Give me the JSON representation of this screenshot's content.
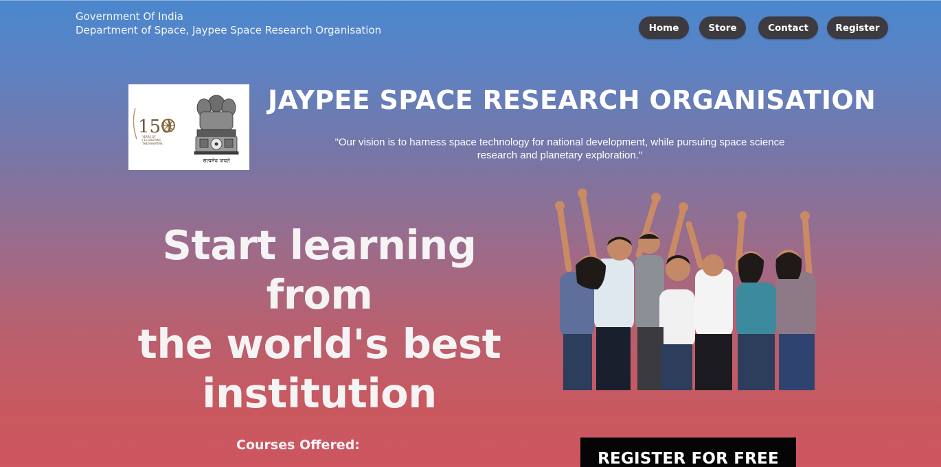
{
  "header": {
    "line1": "Government Of India",
    "line2": "Department of Space, Jaypee Space Research Organisation"
  },
  "nav": {
    "items": [
      {
        "label": "Home"
      },
      {
        "label": "Store"
      },
      {
        "label": "Contact"
      },
      {
        "label": "Register"
      }
    ]
  },
  "org": {
    "title": "JAYPEE SPACE RESEARCH ORGANISATION",
    "vision_line1": "\"Our vision is to harness space technology for national development,  while pursuing space science",
    "vision_line2": "research and planetary exploration.\""
  },
  "emblem": {
    "badge_number": "150",
    "badge_caption1": "YEARS OF",
    "badge_caption2": "CELEBRATING",
    "badge_caption3": "THE MAHATMA",
    "motto": "सत्यमेव जयते"
  },
  "hero": {
    "line1": "Start learning from",
    "line2": "the world's best",
    "line3": "institution"
  },
  "courses": {
    "label": "Courses Offered:"
  },
  "cta": {
    "label": "REGISTER FOR FREE"
  },
  "colors": {
    "gradient_top": "#4a87cd",
    "gradient_bottom": "#cd5660",
    "nav_button": "#3d3b3f",
    "cta_background": "#050505"
  }
}
